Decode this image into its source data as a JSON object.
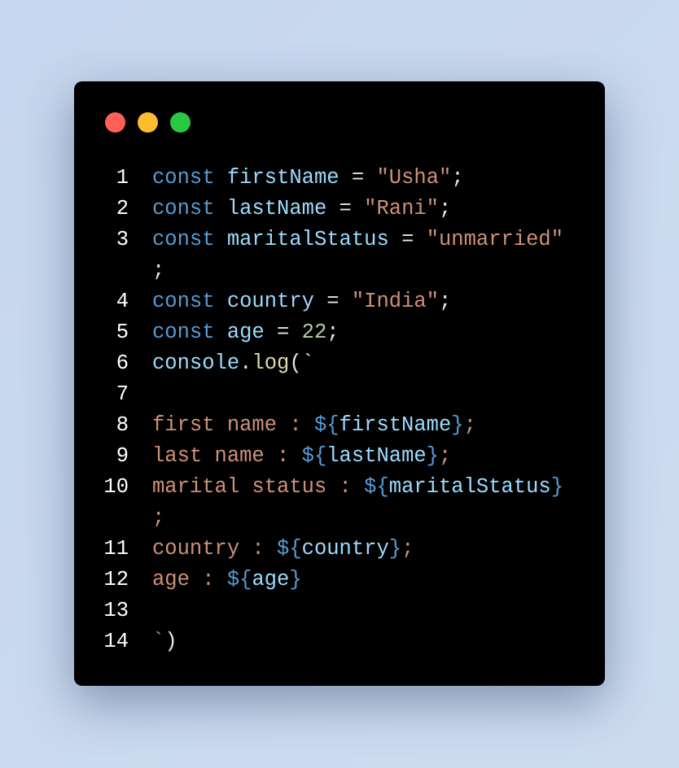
{
  "window_controls": {
    "close_color": "#ff5f57",
    "minimize_color": "#febc2e",
    "maximize_color": "#28c840"
  },
  "code_lines": [
    {
      "number": "1",
      "rows": [
        [
          [
            "const",
            "kw"
          ],
          [
            " ",
            "punc"
          ],
          [
            "firstName",
            "var"
          ],
          [
            " = ",
            "punc"
          ],
          [
            "\"Usha\"",
            "str"
          ],
          [
            ";",
            "punc"
          ]
        ]
      ]
    },
    {
      "number": "2",
      "rows": [
        [
          [
            "const",
            "kw"
          ],
          [
            " ",
            "punc"
          ],
          [
            "lastName",
            "var"
          ],
          [
            " = ",
            "punc"
          ],
          [
            "\"Rani\"",
            "str"
          ],
          [
            ";",
            "punc"
          ]
        ]
      ]
    },
    {
      "number": "3",
      "rows": [
        [
          [
            "const",
            "kw"
          ],
          [
            " ",
            "punc"
          ],
          [
            "maritalStatus",
            "var"
          ],
          [
            " = ",
            "punc"
          ],
          [
            "\"unmarried\"",
            "str"
          ]
        ],
        [
          [
            ";",
            "punc"
          ]
        ]
      ]
    },
    {
      "number": "4",
      "rows": [
        [
          [
            "const",
            "kw"
          ],
          [
            " ",
            "punc"
          ],
          [
            "country",
            "var"
          ],
          [
            " = ",
            "punc"
          ],
          [
            "\"India\"",
            "str"
          ],
          [
            ";",
            "punc"
          ]
        ]
      ]
    },
    {
      "number": "5",
      "rows": [
        [
          [
            "const",
            "kw"
          ],
          [
            " ",
            "punc"
          ],
          [
            "age",
            "var"
          ],
          [
            " = ",
            "punc"
          ],
          [
            "22",
            "num"
          ],
          [
            ";",
            "punc"
          ]
        ]
      ]
    },
    {
      "number": "6",
      "rows": [
        [
          [
            "console",
            "var"
          ],
          [
            ".",
            "punc"
          ],
          [
            "log",
            "fn"
          ],
          [
            "(`",
            "punc"
          ]
        ]
      ]
    },
    {
      "number": "7",
      "rows": [
        []
      ]
    },
    {
      "number": "8",
      "rows": [
        [
          [
            "first name : ",
            "str"
          ],
          [
            "${",
            "tpl"
          ],
          [
            "firstName",
            "var"
          ],
          [
            "}",
            "tpl"
          ],
          [
            ";",
            "str"
          ]
        ]
      ]
    },
    {
      "number": "9",
      "rows": [
        [
          [
            "last name : ",
            "str"
          ],
          [
            "${",
            "tpl"
          ],
          [
            "lastName",
            "var"
          ],
          [
            "}",
            "tpl"
          ],
          [
            ";",
            "str"
          ]
        ]
      ]
    },
    {
      "number": "10",
      "rows": [
        [
          [
            "marital status : ",
            "str"
          ],
          [
            "${",
            "tpl"
          ],
          [
            "maritalStatus",
            "var"
          ],
          [
            "}",
            "tpl"
          ]
        ],
        [
          [
            ";",
            "str"
          ]
        ]
      ]
    },
    {
      "number": "11",
      "rows": [
        [
          [
            "country : ",
            "str"
          ],
          [
            "${",
            "tpl"
          ],
          [
            "country",
            "var"
          ],
          [
            "}",
            "tpl"
          ],
          [
            ";",
            "str"
          ]
        ]
      ]
    },
    {
      "number": "12",
      "rows": [
        [
          [
            "age : ",
            "str"
          ],
          [
            "${",
            "tpl"
          ],
          [
            "age",
            "var"
          ],
          [
            "}",
            "tpl"
          ]
        ]
      ]
    },
    {
      "number": "13",
      "rows": [
        []
      ]
    },
    {
      "number": "14",
      "rows": [
        [
          [
            "`",
            "str"
          ],
          [
            ")",
            "punc"
          ]
        ]
      ]
    }
  ]
}
